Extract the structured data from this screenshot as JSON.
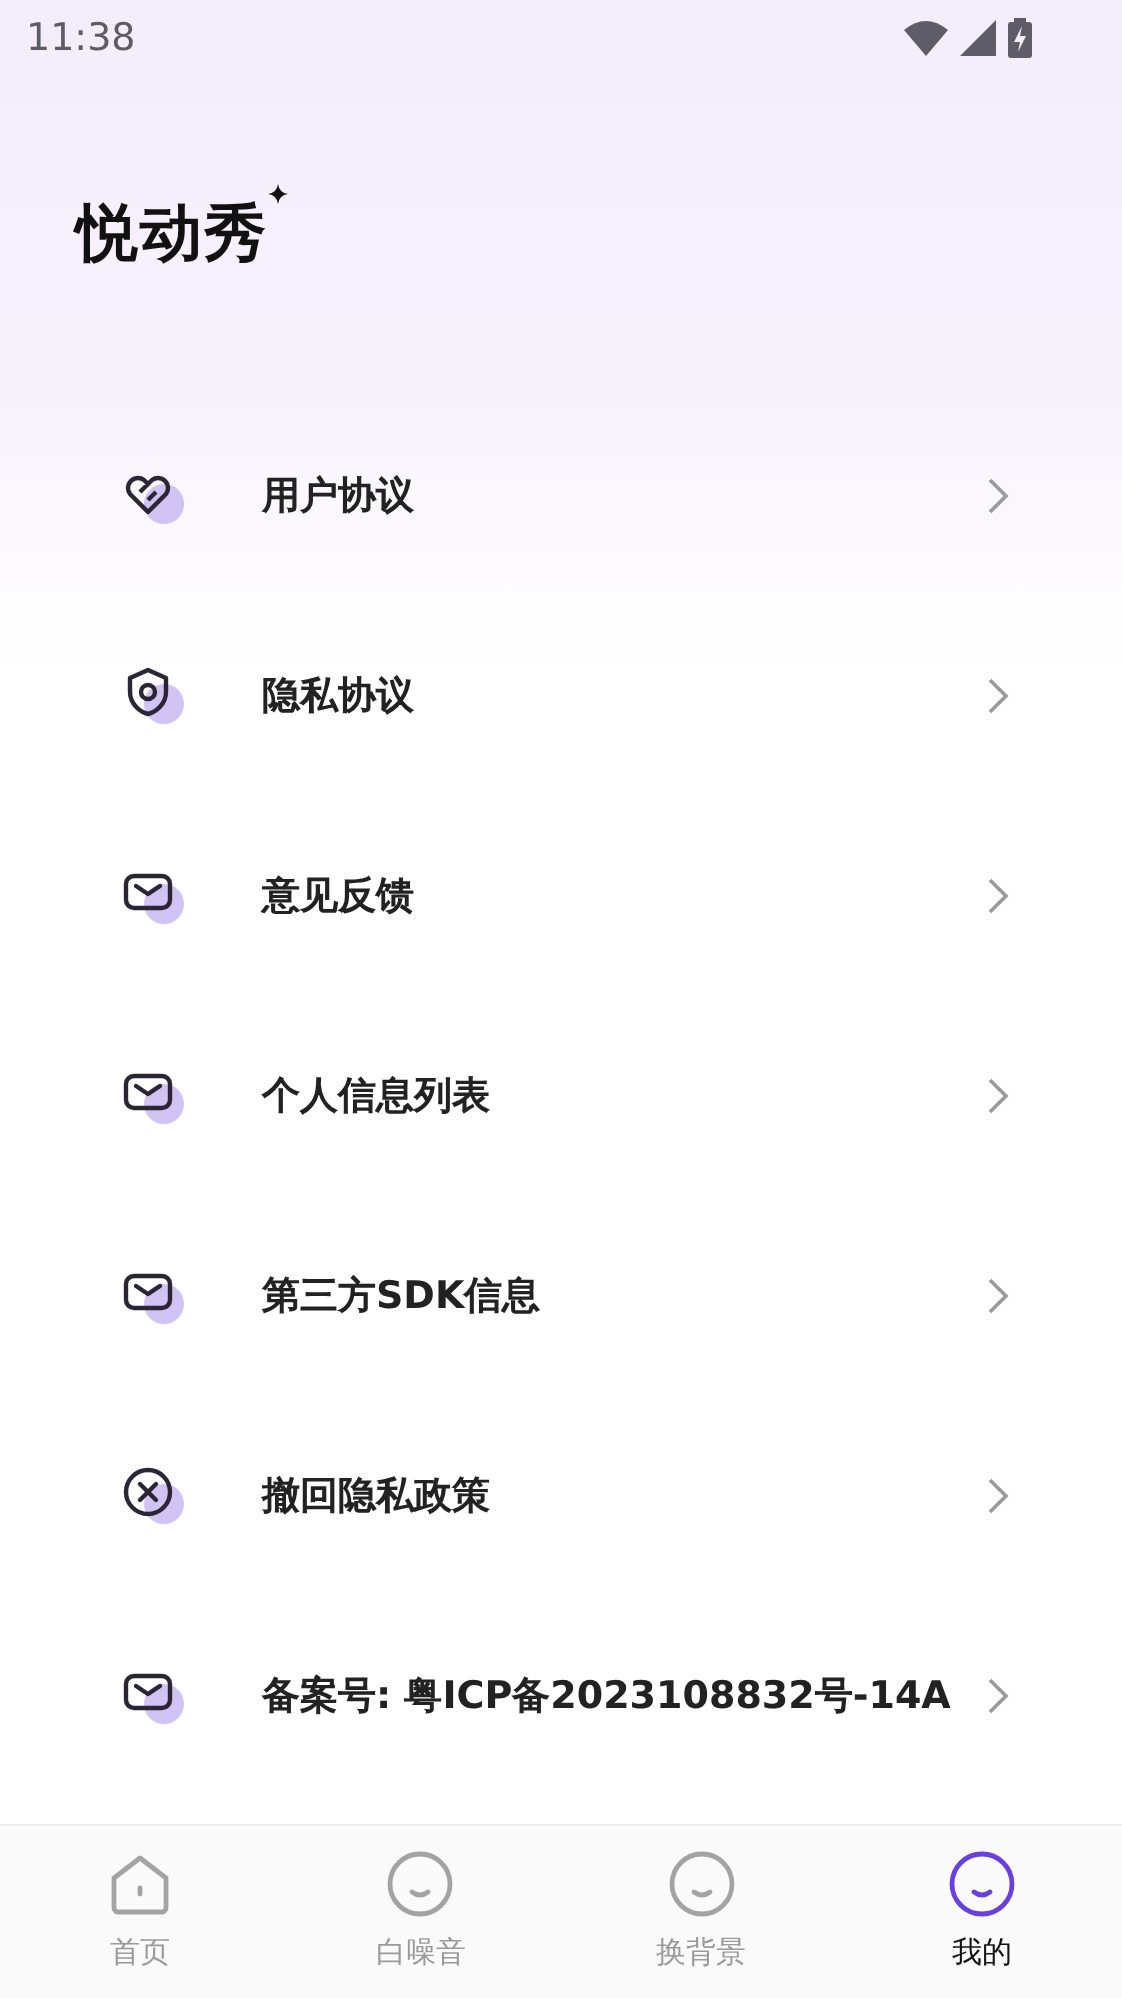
{
  "status_bar": {
    "time": "11:38"
  },
  "app": {
    "logo": "悦动秀"
  },
  "menu": [
    {
      "label": "用户协议",
      "kind": "heart"
    },
    {
      "label": "隐私协议",
      "kind": "shield"
    },
    {
      "label": "意见反馈",
      "kind": "mail"
    },
    {
      "label": "个人信息列表",
      "kind": "mail"
    },
    {
      "label": "第三方SDK信息",
      "kind": "mail"
    },
    {
      "label": "撤回隐私政策",
      "kind": "cancel"
    },
    {
      "label": "备案号: 粤ICP备2023108832号-14A",
      "kind": "mail"
    }
  ],
  "tabs": [
    {
      "label": "首页",
      "kind": "home",
      "selected": false
    },
    {
      "label": "白噪音",
      "kind": "face",
      "selected": false
    },
    {
      "label": "换背景",
      "kind": "face",
      "selected": false
    },
    {
      "label": "我的",
      "kind": "face",
      "selected": true
    }
  ]
}
